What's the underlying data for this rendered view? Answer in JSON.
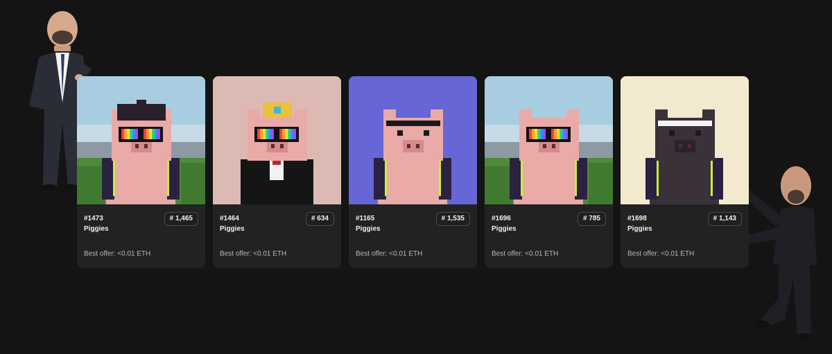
{
  "cards": [
    {
      "title": "#1473",
      "collection": "Piggies",
      "rank": "# 1,465",
      "offer": "Best offer: <0.01 ETH",
      "bg": "scenery",
      "skin": "pink",
      "hat": "beanie",
      "glasses": "rainbow",
      "body": "vest"
    },
    {
      "title": "#1464",
      "collection": "Piggies",
      "rank": "# 634",
      "offer": "Best offer: <0.01 ETH",
      "bg": "#dcbab3",
      "skin": "pink",
      "hat": "crown",
      "glasses": "rainbow",
      "body": "tuxedo"
    },
    {
      "title": "#1165",
      "collection": "Piggies",
      "rank": "# 1,535",
      "offer": "Best offer: <0.01 ETH",
      "bg": "#6666d6",
      "skin": "pink",
      "hat": "headband-black",
      "glasses": "none",
      "body": "vest"
    },
    {
      "title": "#1696",
      "collection": "Piggies",
      "rank": "# 785",
      "offer": "Best offer: <0.01 ETH",
      "bg": "scenery",
      "skin": "pink",
      "hat": "none",
      "glasses": "rainbow",
      "body": "vest"
    },
    {
      "title": "#1698",
      "collection": "Piggies",
      "rank": "# 1,143",
      "offer": "Best offer: <0.01 ETH",
      "bg": "#f3e9cf",
      "skin": "dark",
      "hat": "headband-white",
      "glasses": "none",
      "body": "vest"
    }
  ],
  "colors": {
    "page_bg": "#141414",
    "card_bg": "#222224",
    "pink": "#e9aaa8",
    "dark": "#3a3238",
    "accent_neon": "#c8f03c"
  },
  "icons": [
    "pig-avatar-icon",
    "person-cutout-left",
    "person-cutout-right"
  ]
}
